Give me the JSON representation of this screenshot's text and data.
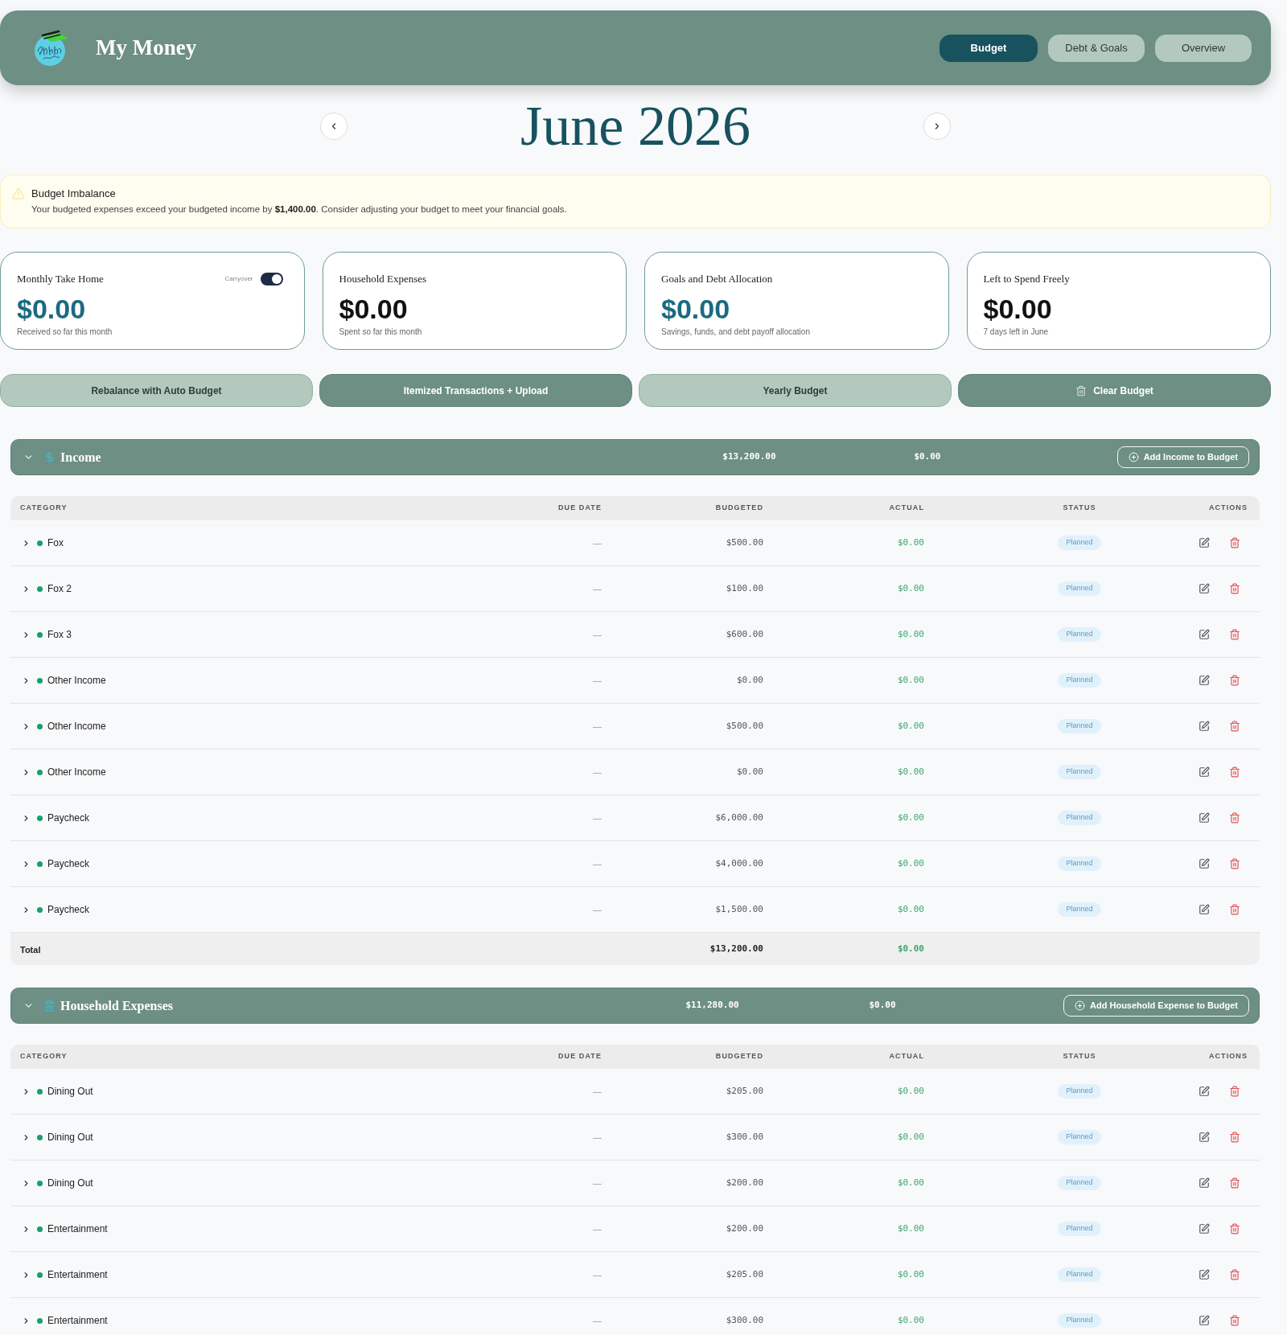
{
  "header": {
    "title": "My Money",
    "tabs": [
      {
        "label": "Budget",
        "selected": true
      },
      {
        "label": "Debt & Goals",
        "selected": false
      },
      {
        "label": "Overview",
        "selected": false
      }
    ]
  },
  "month": {
    "title": "June 2026"
  },
  "alert": {
    "title": "Budget Imbalance",
    "message": "Your budgeted expenses exceed your budgeted income by **$1,400.00**. Consider adjusting your budget to meet your financial goals."
  },
  "cards": [
    {
      "title": "Monthly Take Home",
      "amount": "$0.00",
      "color": "#1b6b80",
      "caption": "Received so far this month",
      "toggle": {
        "label": "Carryover",
        "on": true
      }
    },
    {
      "title": "Household Expenses",
      "amount": "$0.00",
      "color": "#111111",
      "caption": "Spent so far this month"
    },
    {
      "title": "Goals and Debt Allocation",
      "amount": "$0.00",
      "color": "#1b6b80",
      "caption": "Savings, funds, and debt payoff allocation"
    },
    {
      "title": "Left to Spend Freely",
      "amount": "$0.00",
      "color": "#111111",
      "caption": "7 days left in June"
    }
  ],
  "actions": [
    {
      "label": "Rebalance with Auto Budget",
      "kind": "secondary"
    },
    {
      "label": "Itemized Transactions + Upload",
      "kind": "primary"
    },
    {
      "label": "Yearly Budget",
      "kind": "secondary"
    },
    {
      "label": "Clear Budget",
      "kind": "danger"
    }
  ],
  "sections": [
    {
      "kind": "income",
      "title": "Income",
      "expanded": true,
      "budgeted": "$13,200.00",
      "actual": "$0.00",
      "add_button": "Add Income to Budget",
      "columns": [
        "CATEGORY",
        "DUE DATE",
        "BUDGETED",
        "ACTUAL",
        "STATUS",
        "ACTIONS"
      ],
      "rows": [
        {
          "name": "Fox",
          "due_date": "—",
          "budgeted": "$500.00",
          "actual": "$0.00",
          "status": "Planned",
          "expanded": false
        },
        {
          "name": "Fox 2",
          "due_date": "—",
          "budgeted": "$100.00",
          "actual": "$0.00",
          "status": "Planned",
          "expanded": false
        },
        {
          "name": "Fox 3",
          "due_date": "—",
          "budgeted": "$600.00",
          "actual": "$0.00",
          "status": "Planned",
          "expanded": false
        },
        {
          "name": "Other Income",
          "due_date": "—",
          "budgeted": "$0.00",
          "actual": "$0.00",
          "status": "Planned",
          "expanded": false
        },
        {
          "name": "Other Income",
          "due_date": "—",
          "budgeted": "$500.00",
          "actual": "$0.00",
          "status": "Planned",
          "expanded": false
        },
        {
          "name": "Other Income",
          "due_date": "—",
          "budgeted": "$0.00",
          "actual": "$0.00",
          "status": "Planned",
          "expanded": false
        },
        {
          "name": "Paycheck",
          "due_date": "—",
          "budgeted": "$6,000.00",
          "actual": "$0.00",
          "status": "Planned",
          "expanded": false
        },
        {
          "name": "Paycheck",
          "due_date": "—",
          "budgeted": "$4,000.00",
          "actual": "$0.00",
          "status": "Planned",
          "expanded": false
        },
        {
          "name": "Paycheck",
          "due_date": "—",
          "budgeted": "$1,500.00",
          "actual": "$0.00",
          "status": "Planned",
          "expanded": false
        }
      ],
      "total": {
        "label": "Total",
        "budgeted": "$13,200.00",
        "actual": "$0.00"
      }
    },
    {
      "kind": "household",
      "title": "Household Expenses",
      "expanded": true,
      "budgeted": "$11,280.00",
      "actual": "$0.00",
      "add_button": "Add Household Expense to Budget",
      "columns": [
        "CATEGORY",
        "DUE DATE",
        "BUDGETED",
        "ACTUAL",
        "STATUS",
        "ACTIONS"
      ],
      "rows": [
        {
          "name": "Dining Out",
          "due_date": "—",
          "budgeted": "$205.00",
          "actual": "$0.00",
          "status": "Planned",
          "expanded": false
        },
        {
          "name": "Dining Out",
          "due_date": "—",
          "budgeted": "$300.00",
          "actual": "$0.00",
          "status": "Planned",
          "expanded": false
        },
        {
          "name": "Dining Out",
          "due_date": "—",
          "budgeted": "$200.00",
          "actual": "$0.00",
          "status": "Planned",
          "expanded": false
        },
        {
          "name": "Entertainment",
          "due_date": "—",
          "budgeted": "$200.00",
          "actual": "$0.00",
          "status": "Planned",
          "expanded": false
        },
        {
          "name": "Entertainment",
          "due_date": "—",
          "budgeted": "$205.00",
          "actual": "$0.00",
          "status": "Planned",
          "expanded": false
        },
        {
          "name": "Entertainment",
          "due_date": "—",
          "budgeted": "$300.00",
          "actual": "$0.00",
          "status": "Planned",
          "expanded": false
        }
      ]
    }
  ]
}
